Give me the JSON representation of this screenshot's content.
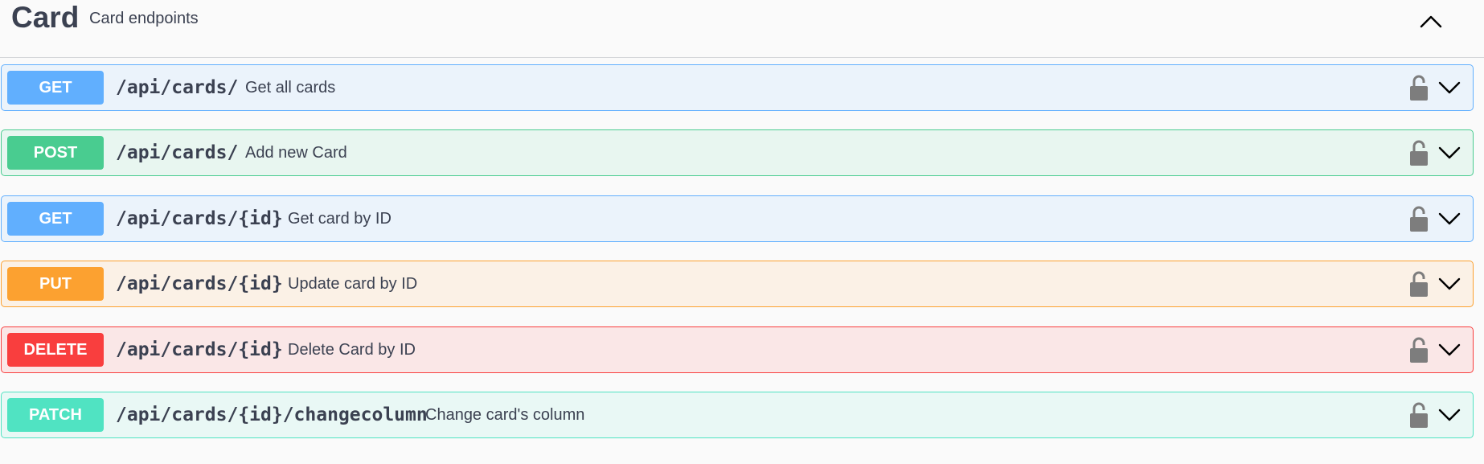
{
  "tag": {
    "title": "Card",
    "description": "Card endpoints",
    "collapse_icon": "chevron-up-icon"
  },
  "colors": {
    "get": "#61affe",
    "post": "#49cc90",
    "put": "#fca130",
    "delete": "#f93e3e",
    "patch": "#50e3c2"
  },
  "operations": [
    {
      "method": "GET",
      "path": "/api/cards/",
      "summary": "Get all cards",
      "lock_icon": "unlocked-icon",
      "expand_icon": "chevron-down-icon"
    },
    {
      "method": "POST",
      "path": "/api/cards/",
      "summary": "Add new Card",
      "lock_icon": "unlocked-icon",
      "expand_icon": "chevron-down-icon"
    },
    {
      "method": "GET",
      "path": "/api/cards/{id}",
      "summary": "Get card by ID",
      "lock_icon": "unlocked-icon",
      "expand_icon": "chevron-down-icon"
    },
    {
      "method": "PUT",
      "path": "/api/cards/{id}",
      "summary": "Update card by ID",
      "lock_icon": "unlocked-icon",
      "expand_icon": "chevron-down-icon"
    },
    {
      "method": "DELETE",
      "path": "/api/cards/{id}",
      "summary": "Delete Card by ID",
      "lock_icon": "unlocked-icon",
      "expand_icon": "chevron-down-icon"
    },
    {
      "method": "PATCH",
      "path": "/api/cards/{id}/changecolumn",
      "summary": "Change card's column",
      "lock_icon": "unlocked-icon",
      "expand_icon": "chevron-down-icon"
    }
  ]
}
